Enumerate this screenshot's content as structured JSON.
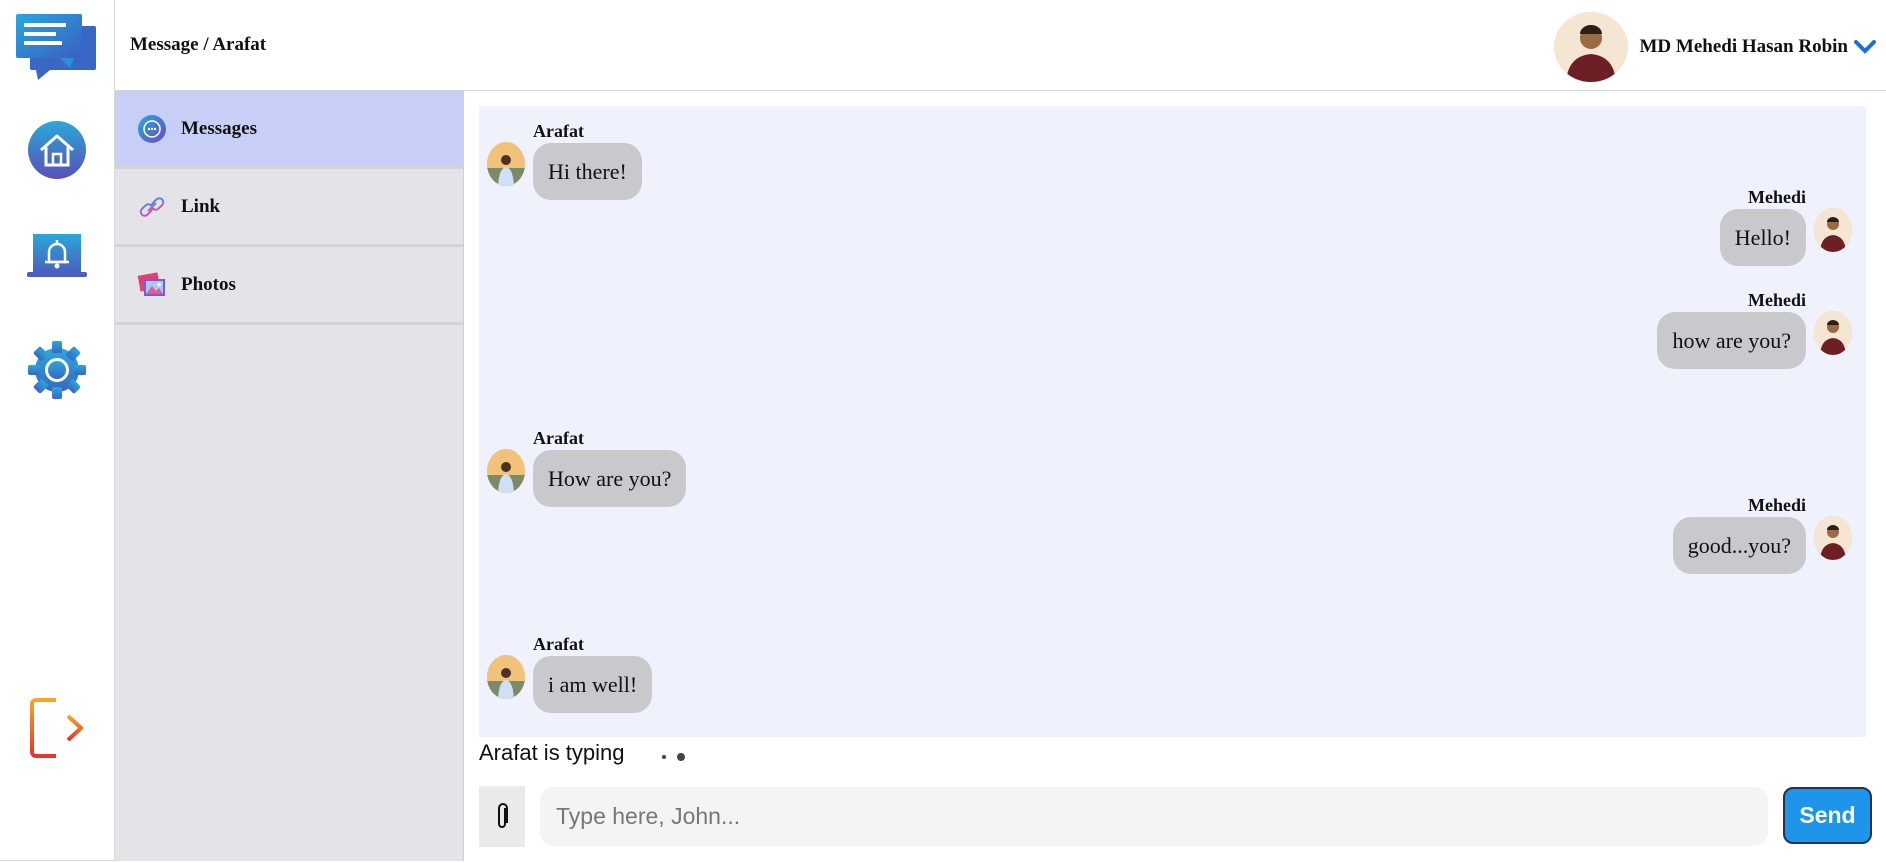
{
  "header": {
    "breadcrumb": "Message / Arafat",
    "user_name": "MD Mehedi Hasan Robin"
  },
  "rail": {
    "icons": [
      "chat-logo-icon",
      "home-icon",
      "notification-bell-icon",
      "gear-icon",
      "logout-icon"
    ]
  },
  "sidebar": {
    "items": [
      {
        "label": "Messages",
        "icon": "messages-icon",
        "active": true
      },
      {
        "label": "Link",
        "icon": "link-icon",
        "active": false
      },
      {
        "label": "Photos",
        "icon": "photos-icon",
        "active": false
      }
    ]
  },
  "chat": {
    "messages": [
      {
        "sender": "Arafat",
        "text": "Hi there!",
        "side": "left"
      },
      {
        "sender": "Mehedi",
        "text": "Hello!",
        "side": "right"
      },
      {
        "sender": "Mehedi",
        "text": "how are you?",
        "side": "right"
      },
      {
        "sender": "Arafat",
        "text": "How are you?",
        "side": "left"
      },
      {
        "sender": "Mehedi",
        "text": "good...you?",
        "side": "right"
      },
      {
        "sender": "Arafat",
        "text": "i am well!",
        "side": "left"
      }
    ],
    "typing_text": "Arafat is typing"
  },
  "composer": {
    "placeholder": "Type here, John...",
    "send_label": "Send"
  },
  "colors": {
    "accent": "#1e95ea",
    "active_nav": "#c8cff7",
    "chat_bg": "#eff2fd",
    "bubble": "#c9c9cd",
    "sidebar_bg": "#e3e3e8"
  }
}
